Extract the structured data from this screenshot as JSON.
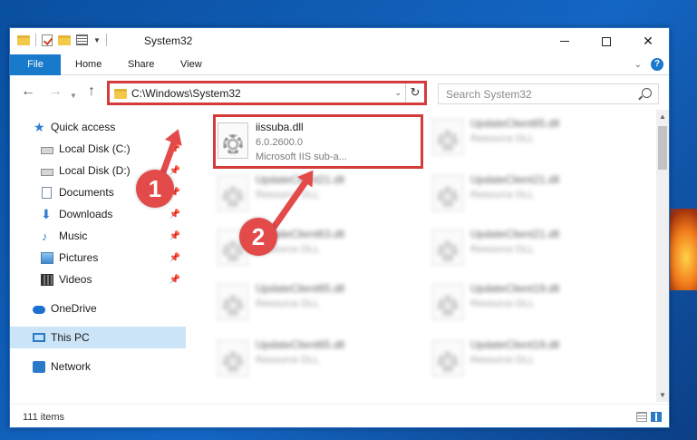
{
  "window": {
    "title": "System32"
  },
  "ribbon": {
    "tabs": [
      {
        "label": "File"
      },
      {
        "label": "Home"
      },
      {
        "label": "Share"
      },
      {
        "label": "View"
      }
    ],
    "help_label": "?"
  },
  "address_bar": {
    "path": "C:\\Windows\\System32"
  },
  "search": {
    "placeholder": "Search System32"
  },
  "sidebar": {
    "items": [
      {
        "label": "Quick access",
        "icon": "star-icon"
      },
      {
        "label": "Local Disk (C:)",
        "icon": "drive-icon",
        "pinned": true
      },
      {
        "label": "Local Disk (D:)",
        "icon": "drive-icon",
        "pinned": true
      },
      {
        "label": "Documents",
        "icon": "document-icon",
        "pinned": true
      },
      {
        "label": "Downloads",
        "icon": "download-icon",
        "pinned": true
      },
      {
        "label": "Music",
        "icon": "music-icon",
        "pinned": true
      },
      {
        "label": "Pictures",
        "icon": "pictures-icon",
        "pinned": true
      },
      {
        "label": "Videos",
        "icon": "videos-icon",
        "pinned": true
      },
      {
        "label": "OneDrive",
        "icon": "onedrive-icon"
      },
      {
        "label": "This PC",
        "icon": "this-pc-icon",
        "selected": true
      },
      {
        "label": "Network",
        "icon": "network-icon"
      }
    ]
  },
  "files": {
    "highlighted": {
      "name": "iissuba.dll",
      "version": "6.0.2600.0",
      "description": "Microsoft IIS sub-a..."
    },
    "blurred": [
      {
        "name": "UpdateClient65.dll",
        "type": "Resource DLL"
      },
      {
        "name": "UpdateClient21.dll",
        "type": "Resource DLL"
      },
      {
        "name": "UpdateClient21.dll",
        "type": "Resource DLL"
      },
      {
        "name": "UpdateClient63.dll",
        "type": "Resource DLL"
      },
      {
        "name": "UpdateClient21.dll",
        "type": "Resource DLL"
      },
      {
        "name": "UpdateClient65.dll",
        "type": "Resource DLL"
      },
      {
        "name": "UpdateClient19.dll",
        "type": "Resource DLL"
      },
      {
        "name": "UpdateClient65.dll",
        "type": "Resource DLL"
      },
      {
        "name": "UpdateClient19.dll",
        "type": "Resource DLL"
      }
    ]
  },
  "status_bar": {
    "item_count": "111 items"
  },
  "callouts": [
    {
      "number": "1"
    },
    {
      "number": "2"
    }
  ],
  "colors": {
    "accent": "#1979ca",
    "callout_red": "#e34a4a",
    "selected_bg": "#cce4f7"
  }
}
